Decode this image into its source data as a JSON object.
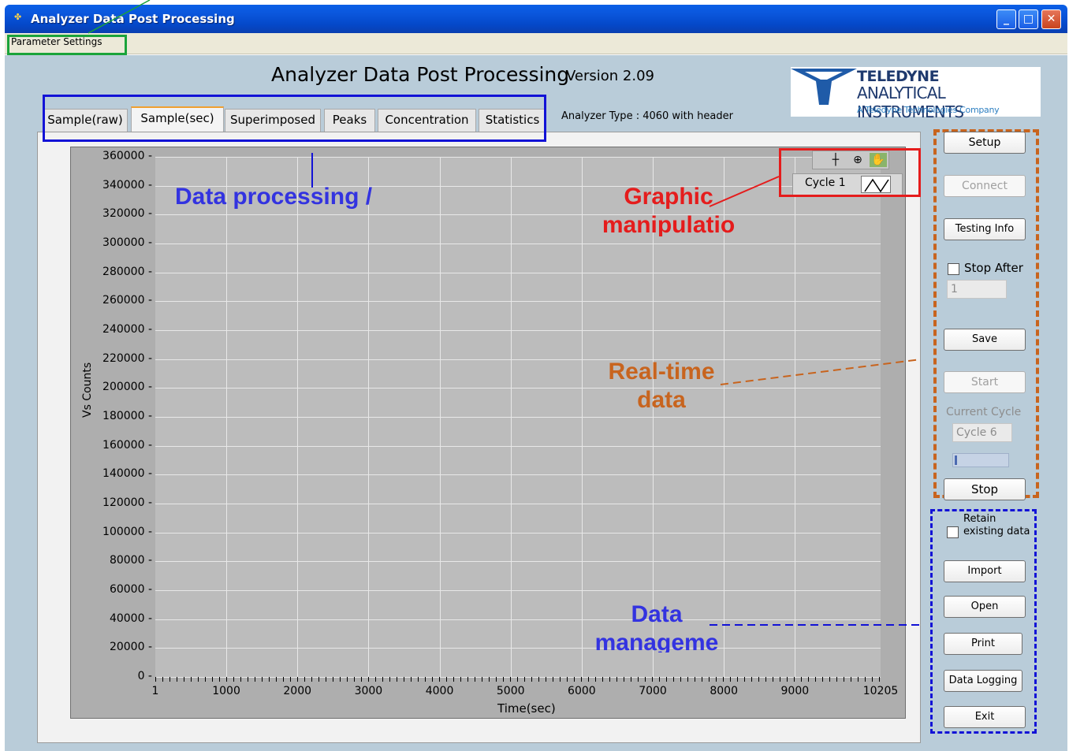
{
  "window": {
    "title": "Analyzer Data Post Processing",
    "minimize": "_",
    "maximize": "□",
    "close": "✕"
  },
  "menu": {
    "parameter_settings": "Parameter Settings"
  },
  "header": {
    "app_title": "Analyzer Data Post Processing",
    "version": "Version 2.09",
    "analyzer_type": "Analyzer Type :   4060 with header"
  },
  "logo": {
    "name": "TELEDYNE",
    "sub": "ANALYTICAL INSTRUMENTS",
    "tagline": "A Teledyne Technologies Company"
  },
  "tabs": [
    {
      "label": "Sample(raw)"
    },
    {
      "label": "Sample(sec)"
    },
    {
      "label": "Superimposed"
    },
    {
      "label": "Peaks"
    },
    {
      "label": "Concentration"
    },
    {
      "label": "Statistics"
    }
  ],
  "graph": {
    "y_ticks": [
      "360000",
      "340000",
      "320000",
      "300000",
      "280000",
      "260000",
      "240000",
      "220000",
      "200000",
      "180000",
      "160000",
      "140000",
      "120000",
      "100000",
      "80000",
      "60000",
      "40000",
      "20000",
      "0"
    ],
    "x_ticks": [
      "1",
      "1000",
      "2000",
      "3000",
      "4000",
      "5000",
      "6000",
      "7000",
      "8000",
      "9000",
      "10205"
    ],
    "ylabel": "Vs Counts",
    "xlabel": "Time(sec)",
    "legend": "Cycle 1"
  },
  "annotations": {
    "data_processing": "Data processing /",
    "graphic": "Graphic manipulatio",
    "realtime": "Real-time data",
    "data_mgmt": "Data manageme"
  },
  "controls": {
    "setup": "Setup",
    "connect": "Connect",
    "testing_info": "Testing Info",
    "stop_after": "Stop After",
    "stop_after_value": "1",
    "save": "Save",
    "start": "Start",
    "current_cycle_label": "Current Cycle",
    "current_cycle_value": "Cycle 6",
    "stop": "Stop",
    "retain": "Retain existing data",
    "import": "Import",
    "open": "Open",
    "print": "Print",
    "data_logging": "Data Logging",
    "exit": "Exit"
  },
  "chart_data": {
    "type": "line",
    "xlabel": "Time(sec)",
    "ylabel": "Vs Counts",
    "xlim": [
      1,
      10205
    ],
    "ylim": [
      0,
      360000
    ],
    "series": [
      {
        "name": "Cycle 1",
        "values": []
      }
    ],
    "grid": true
  }
}
